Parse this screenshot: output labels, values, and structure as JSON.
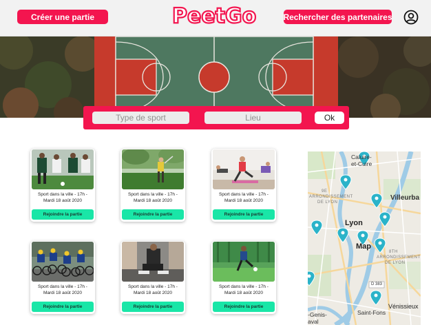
{
  "header": {
    "create_label": "Créer une partie",
    "logo_text": "PeetGo",
    "search_partners_label": "Rechercher des partenaires",
    "profile_icon": "user-circle-icon"
  },
  "search": {
    "sport_placeholder": "Type de sport",
    "place_placeholder": "Lieu",
    "ok_label": "Ok"
  },
  "games": [
    {
      "title": "Sport dans la ville - 17h -",
      "date": "Mardi 18 août 2020",
      "join_label": "Rejoindre la partie",
      "image": "football-players"
    },
    {
      "title": "Sport dans la ville - 17h -",
      "date": "Mardi 18 août 2020",
      "join_label": "Rejoindre la partie",
      "image": "golfer"
    },
    {
      "title": "Sport dans la ville - 17h -",
      "date": "Mardi 18 août 2020",
      "join_label": "Rejoindre la partie",
      "image": "fitness-class"
    },
    {
      "title": "Sport dans la ville - 17h -",
      "date": "Mardi 18 août 2020",
      "join_label": "Rejoindre la partie",
      "image": "cyclists"
    },
    {
      "title": "Sport dans la ville - 17h -",
      "date": "Mardi 18 août 2020",
      "join_label": "Rejoindre la partie",
      "image": "runner-tying-shoe"
    },
    {
      "title": "Sport dans la ville - 17h -",
      "date": "Mardi 18 août 2020",
      "join_label": "Rejoindre la partie",
      "image": "football-kick"
    }
  ],
  "map": {
    "labels": {
      "caluire": "Caluire-",
      "caluire2": "et-Cuire",
      "arr9": "9E",
      "arr9b": "ARRONDISSEMENT",
      "arr9c": "DE LYON",
      "villeurbanne": "Villeurba",
      "lyon": "Lyon",
      "map": "Map",
      "arr8": "8TH",
      "arr8b": "ARRONDISSEMENT",
      "arr8c": "DE LYON",
      "road": "D 383",
      "venissieux": "Vénissieux",
      "saint_fons": "Saint-Fons",
      "genis": "-Genis-",
      "laval": "aval"
    }
  },
  "colors": {
    "brand_pink": "#f3154f",
    "join_green": "#19e6a7",
    "header_bg": "#f2f2f2",
    "map_pin": "#2bb3c9"
  }
}
